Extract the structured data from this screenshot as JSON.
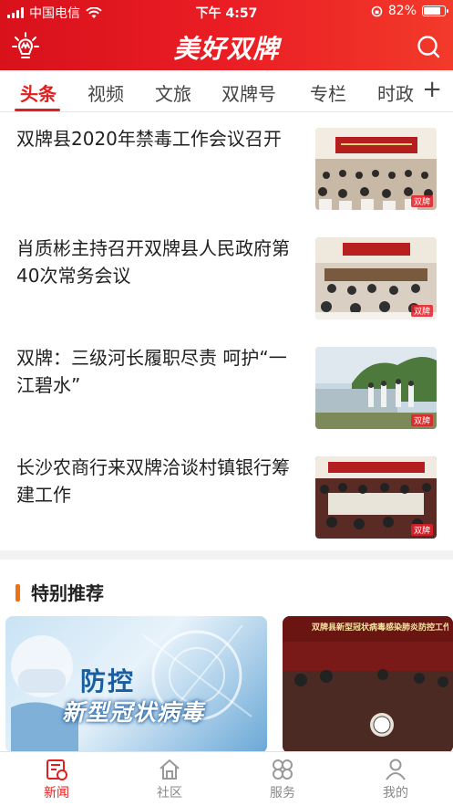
{
  "status_bar": {
    "carrier": "中国电信",
    "time": "下午 4:57",
    "battery": "82%",
    "battery_level": 0.82
  },
  "app_bar": {
    "brand": "美好双牌",
    "logo_icon": "bulb-logo-icon",
    "search_icon": "search-icon"
  },
  "tabs": {
    "items": [
      {
        "label": "头条",
        "active": true
      },
      {
        "label": "视频"
      },
      {
        "label": "文旅"
      },
      {
        "label": "双牌号"
      },
      {
        "label": "专栏"
      },
      {
        "label": "时政"
      }
    ],
    "add_label": "+"
  },
  "news": [
    {
      "title": "双牌县2020年禁毒工作会议召开"
    },
    {
      "title": "肖质彬主持召开双牌县人民政府第40次常务会议"
    },
    {
      "title": "双牌：三级河长履职尽责 呵护“一江碧水”"
    },
    {
      "title": "长沙农商行来双牌洽谈村镇银行筹建工作"
    }
  ],
  "special": {
    "heading": "特别推荐",
    "card_a": {
      "line1": "防控",
      "line2": "新型冠状病毒"
    },
    "card_b": {
      "caption": "双牌县新型冠状病毒感染肺炎防控工作视频会"
    }
  },
  "bottom_nav": {
    "items": [
      {
        "label": "新闻",
        "icon": "news-icon",
        "active": true
      },
      {
        "label": "社区",
        "icon": "home-icon"
      },
      {
        "label": "服务",
        "icon": "services-icon"
      },
      {
        "label": "我的",
        "icon": "profile-icon"
      }
    ]
  },
  "colors": {
    "brand_red": "#e02020",
    "section_accent": "#f07013"
  }
}
